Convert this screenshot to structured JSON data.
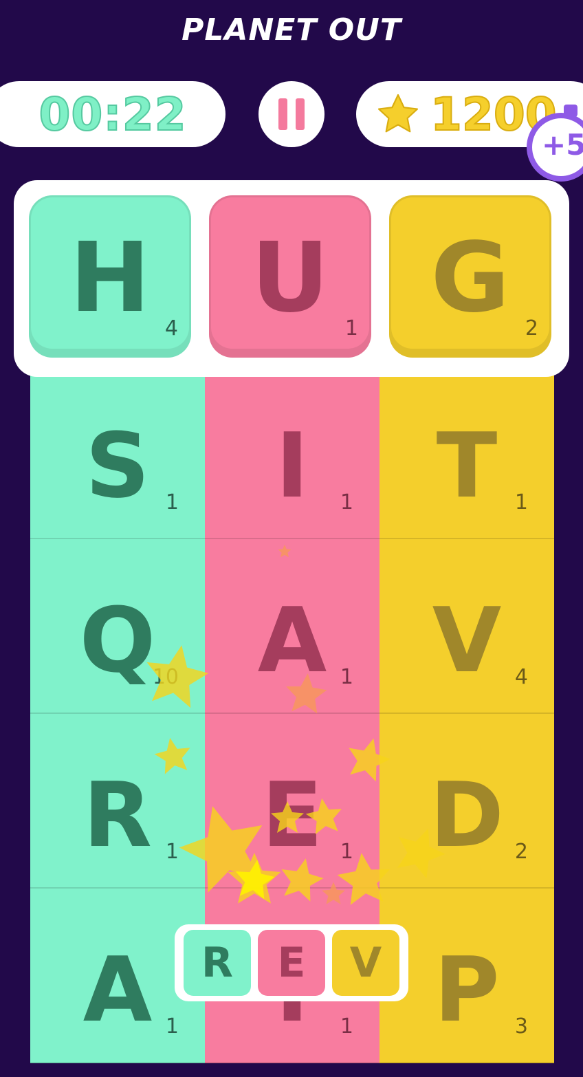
{
  "title": "PLANET OUT",
  "timer": "00:22",
  "score": "1200",
  "bonus": "+5",
  "icons": {
    "pause": "pause-icon",
    "star": "star-icon",
    "stopwatch": "stopwatch-icon"
  },
  "colors": {
    "background": "#22094a",
    "green": "#80f2cb",
    "pink": "#f87c9f",
    "yellow": "#f4cf2c",
    "bonus": "#8e5ae6"
  },
  "current_word": [
    {
      "letter": "H",
      "points": "4"
    },
    {
      "letter": "U",
      "points": "1"
    },
    {
      "letter": "G",
      "points": "2"
    }
  ],
  "grid": [
    [
      {
        "letter": "S",
        "points": "1"
      },
      {
        "letter": "I",
        "points": "1"
      },
      {
        "letter": "T",
        "points": "1"
      }
    ],
    [
      {
        "letter": "Q",
        "points": "10"
      },
      {
        "letter": "A",
        "points": "1"
      },
      {
        "letter": "V",
        "points": "4"
      }
    ],
    [
      {
        "letter": "R",
        "points": "1"
      },
      {
        "letter": "E",
        "points": "1"
      },
      {
        "letter": "D",
        "points": "2"
      }
    ],
    [
      {
        "letter": "A",
        "points": "1"
      },
      {
        "letter": "I",
        "points": "1"
      },
      {
        "letter": "P",
        "points": "3"
      }
    ]
  ],
  "tray": [
    "R",
    "E",
    "V"
  ]
}
